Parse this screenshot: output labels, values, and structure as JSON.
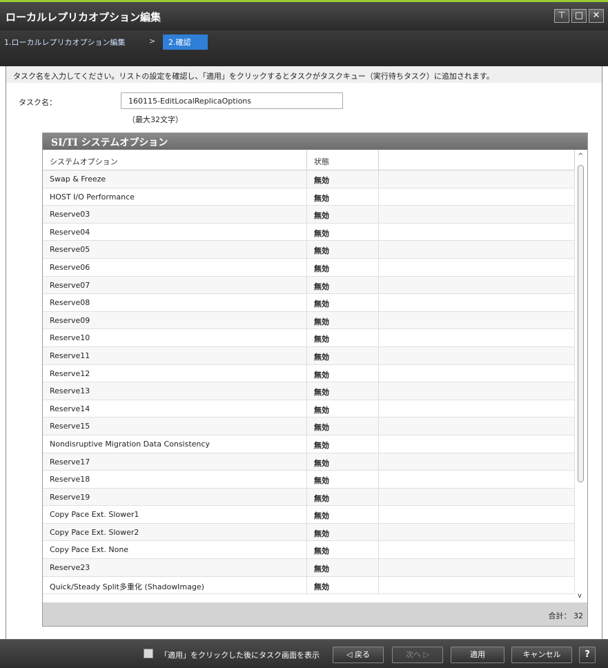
{
  "window": {
    "title": "ローカルレプリカオプション編集",
    "buttons": [
      "⊤",
      "□",
      "✕"
    ]
  },
  "nav": {
    "step1": "1.ローカルレプリカオプション編集",
    "separator": ">",
    "step2": "2.確認"
  },
  "instruction": "タスク名を入力してください。リストの設定を確認し、「適用」をクリックするとタスクがタスクキュー（実行待ちタスク）に追加されます。",
  "task": {
    "label": "タスク名：",
    "value": "160115-EditLocalReplicaOptions",
    "hint": "（最大32文字）"
  },
  "panel": {
    "title": "SI/TI システムオプション",
    "columns": [
      "システムオプション",
      "状態",
      ""
    ],
    "rows": [
      [
        "Swap & Freeze",
        "無効"
      ],
      [
        "HOST I/O Performance",
        "無効"
      ],
      [
        "Reserve03",
        "無効"
      ],
      [
        "Reserve04",
        "無効"
      ],
      [
        "Reserve05",
        "無効"
      ],
      [
        "Reserve06",
        "無効"
      ],
      [
        "Reserve07",
        "無効"
      ],
      [
        "Reserve08",
        "無効"
      ],
      [
        "Reserve09",
        "無効"
      ],
      [
        "Reserve10",
        "無効"
      ],
      [
        "Reserve11",
        "無効"
      ],
      [
        "Reserve12",
        "無効"
      ],
      [
        "Reserve13",
        "無効"
      ],
      [
        "Reserve14",
        "無効"
      ],
      [
        "Reserve15",
        "無効"
      ],
      [
        "Nondisruptive Migration Data Consistency",
        "無効"
      ],
      [
        "Reserve17",
        "無効"
      ],
      [
        "Reserve18",
        "無効"
      ],
      [
        "Reserve19",
        "無効"
      ],
      [
        "Copy Pace Ext. Slower1",
        "無効"
      ],
      [
        "Copy Pace Ext. Slower2",
        "無効"
      ],
      [
        "Copy Pace Ext. None",
        "無効"
      ],
      [
        "Reserve23",
        "無効"
      ],
      [
        "Quick/Steady Split多重化 (ShadowImage)",
        "無効"
      ]
    ],
    "total_label": "合計：",
    "total_value": "32"
  },
  "footer": {
    "checkbox_label": "「適用」をクリックした後にタスク画面を表示",
    "back": "◁ 戻る",
    "next": "次へ ▷",
    "apply": "適用",
    "cancel": "キャンセル",
    "help": "?"
  }
}
